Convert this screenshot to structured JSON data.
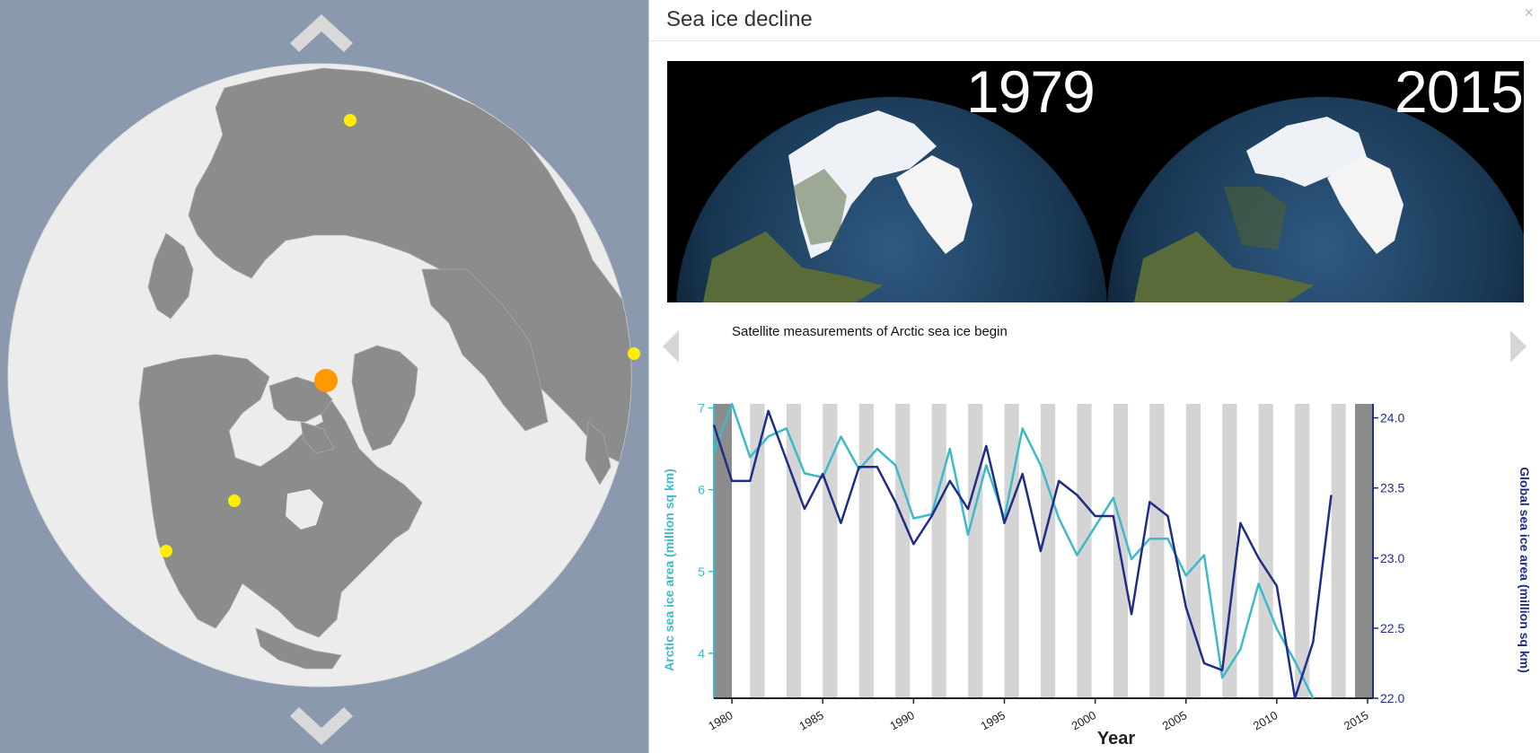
{
  "panel": {
    "title": "Sea ice decline",
    "close_label": "×",
    "image_years": [
      "1979",
      "2015"
    ],
    "caption": "Satellite measurements of Arctic sea ice begin"
  },
  "globe": {
    "markers": [
      {
        "name": "marker-siberia",
        "color": "#ffee00"
      },
      {
        "name": "marker-east",
        "color": "#ffee00"
      },
      {
        "name": "marker-arctic-selected",
        "color": "#ff9900"
      },
      {
        "name": "marker-canada",
        "color": "#ffee00"
      },
      {
        "name": "marker-west-coast",
        "color": "#ffee00"
      }
    ]
  },
  "icons": {
    "up": "chevron-up-icon",
    "down": "chevron-down-icon",
    "prev": "prev-arrow-icon",
    "next": "next-arrow-icon"
  },
  "colors": {
    "arctic": "#3dbac8",
    "global": "#1f2d86",
    "band": "#d4d4d4",
    "band_dark": "#8c8c8c",
    "globe_land": "#8c8c8c",
    "globe_ocean": "#ececec",
    "background": "#8a99ad",
    "marker_selected": "#ff9900",
    "marker": "#ffee00"
  },
  "chart_data": {
    "type": "line",
    "xlabel": "Year",
    "ylabel_left": "Arctic sea ice area (million sq km)",
    "ylabel_right": "Global sea ice area (million sq km)",
    "x_ticks": [
      "1980",
      "1985",
      "1990",
      "1995",
      "2000",
      "2005",
      "2010",
      "2015"
    ],
    "y_left_ticks": [
      "4",
      "5",
      "6",
      "7"
    ],
    "y_right_ticks": [
      "22.0",
      "22.5",
      "23.0",
      "23.5",
      "24.0"
    ],
    "xlim": [
      1979.5,
      2015
    ],
    "ylim_left": [
      3.45,
      7.05
    ],
    "ylim_right": [
      22.0,
      24.1
    ],
    "series": [
      {
        "name": "Arctic sea ice area",
        "axis": "left",
        "x": [
          1979,
          1980,
          1981,
          1982,
          1983,
          1984,
          1985,
          1986,
          1987,
          1988,
          1989,
          1990,
          1991,
          1992,
          1993,
          1994,
          1995,
          1996,
          1997,
          1998,
          1999,
          2000,
          2001,
          2002,
          2003,
          2004,
          2005,
          2006,
          2007,
          2008,
          2009,
          2010,
          2011,
          2012
        ],
        "values": [
          6.45,
          7.05,
          6.4,
          6.65,
          6.75,
          6.2,
          6.15,
          6.65,
          6.25,
          6.5,
          6.3,
          5.65,
          5.7,
          6.5,
          5.45,
          6.3,
          5.65,
          6.75,
          6.3,
          5.65,
          5.2,
          5.55,
          5.9,
          5.15,
          5.4,
          5.4,
          4.95,
          5.2,
          3.7,
          4.05,
          4.85,
          4.3,
          3.9,
          3.45
        ]
      },
      {
        "name": "Global sea ice area",
        "axis": "right",
        "x": [
          1979,
          1980,
          1981,
          1982,
          1983,
          1984,
          1985,
          1986,
          1987,
          1988,
          1989,
          1990,
          1991,
          1992,
          1993,
          1994,
          1995,
          1996,
          1997,
          1998,
          1999,
          2000,
          2001,
          2002,
          2003,
          2004,
          2005,
          2006,
          2007,
          2008,
          2009,
          2010,
          2011,
          2012,
          2013
        ],
        "values": [
          23.95,
          23.55,
          23.55,
          24.05,
          23.7,
          23.35,
          23.6,
          23.25,
          23.65,
          23.65,
          23.4,
          23.1,
          23.3,
          23.55,
          23.35,
          23.8,
          23.25,
          23.6,
          23.05,
          23.55,
          23.45,
          23.3,
          23.3,
          22.6,
          23.4,
          23.3,
          22.65,
          22.25,
          22.2,
          23.25,
          23.0,
          22.8,
          21.95,
          22.4,
          23.45
        ]
      }
    ]
  }
}
